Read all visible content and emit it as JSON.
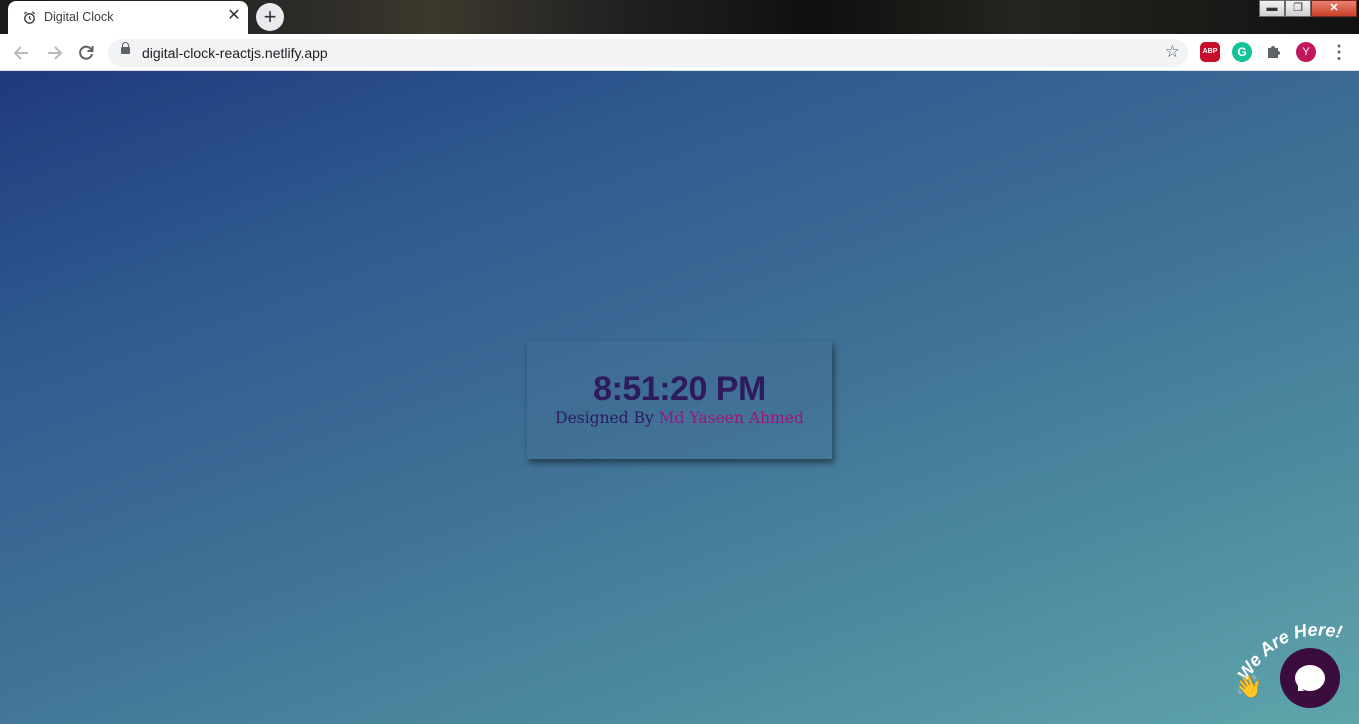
{
  "browser": {
    "tab": {
      "title": "Digital Clock",
      "favicon": "alarm-clock-icon",
      "close": "✕"
    },
    "new_tab": "+",
    "window_buttons": {
      "minimize": "▬",
      "restore": "❐",
      "close": "✕"
    },
    "address": {
      "url": "digital-clock-reactjs.netlify.app"
    },
    "extensions": {
      "abp": "ABP",
      "grammarly": "G",
      "profile": "Y"
    }
  },
  "page": {
    "clock": {
      "time": "8:51:20 PM",
      "credit_prefix": "Designed By",
      "credit_name": "Md Yaseen Ahmed"
    },
    "chat": {
      "label": "We Are Here!",
      "wave": "👋"
    }
  },
  "colors": {
    "time": "#2e1b5c",
    "credit_name": "#a0147e",
    "chat_bubble": "#3a0d3e"
  }
}
